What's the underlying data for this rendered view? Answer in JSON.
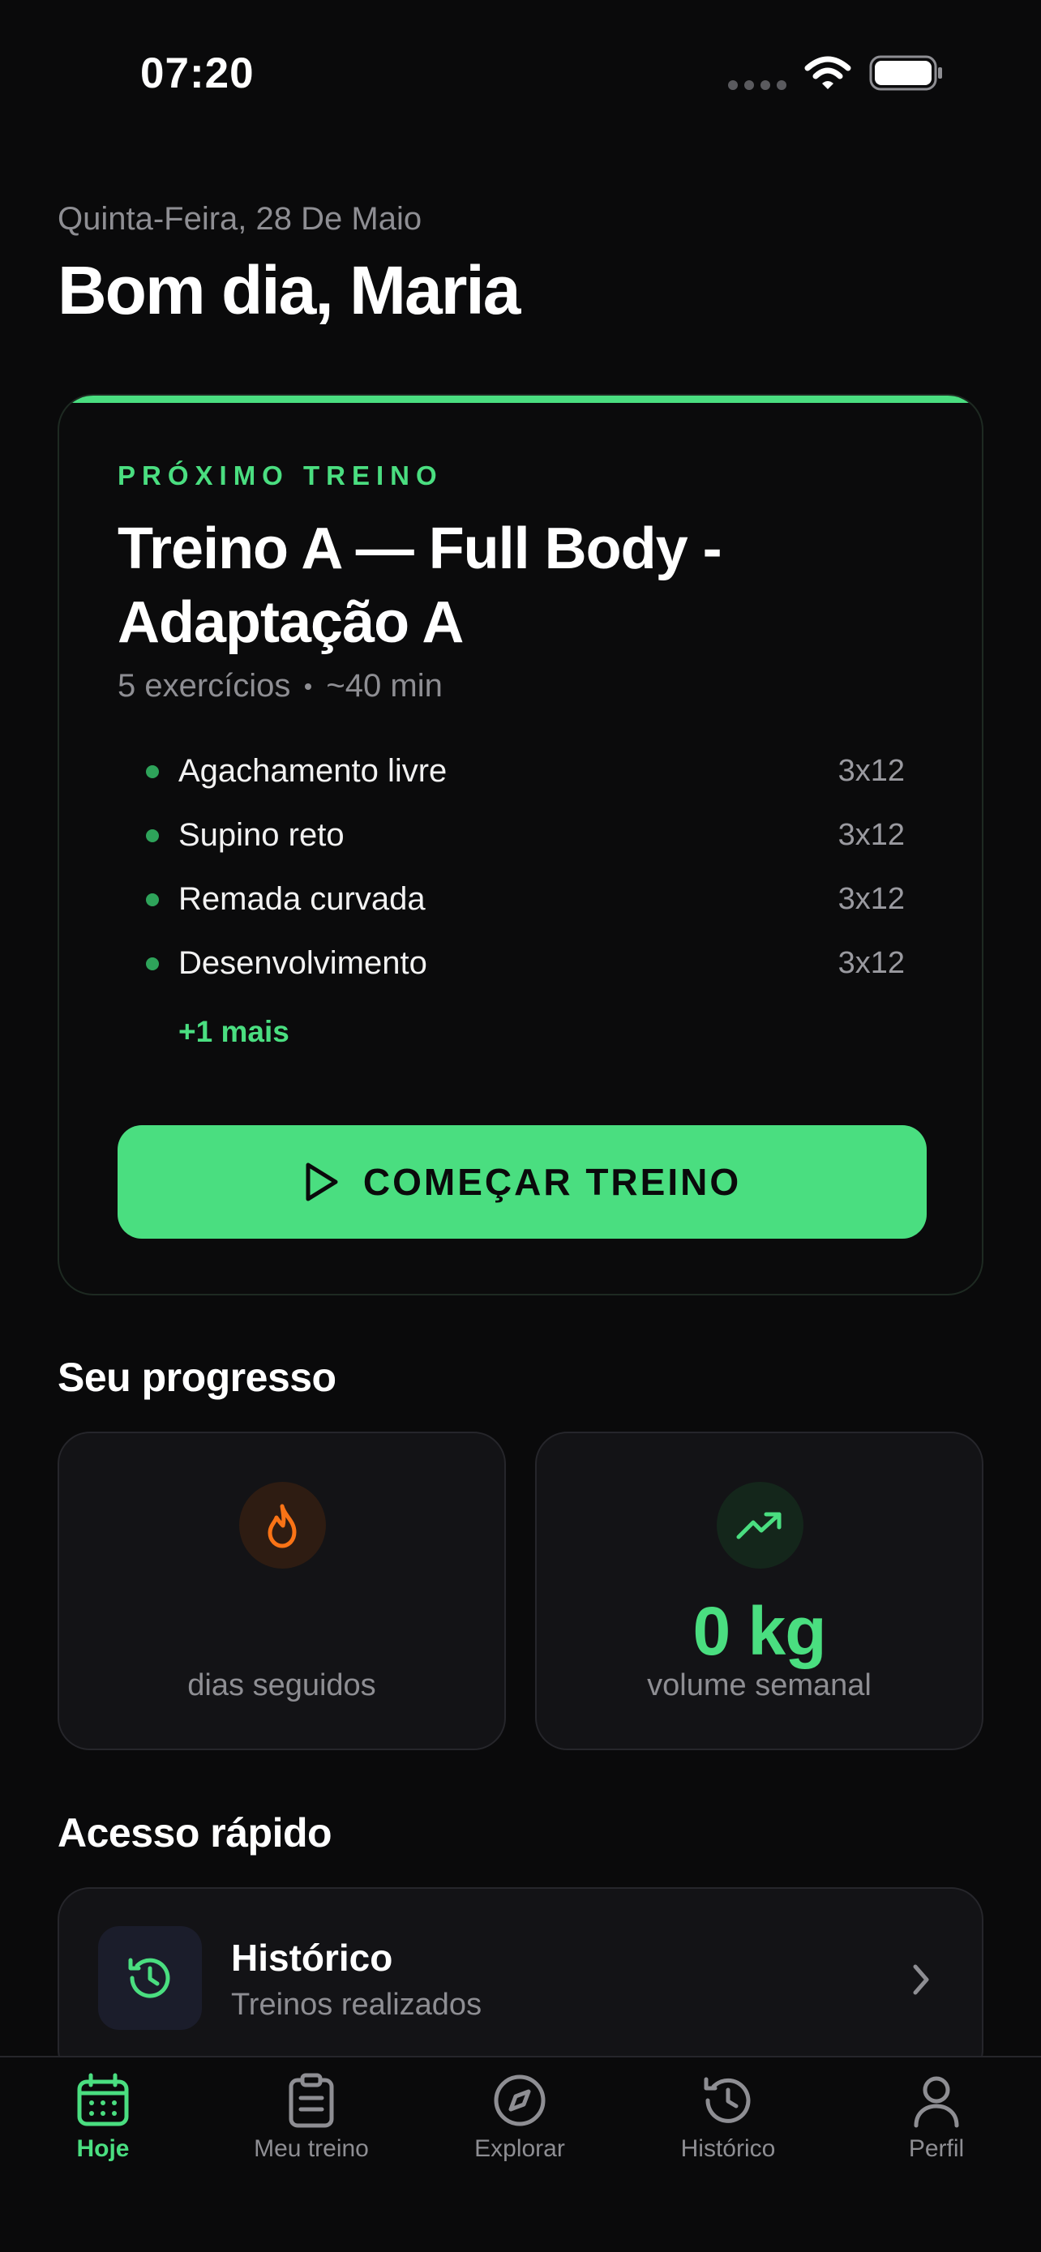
{
  "status_bar": {
    "time": "07:20"
  },
  "header": {
    "date": "Quinta-Feira, 28 De Maio",
    "greeting": "Bom dia, Maria"
  },
  "next_workout": {
    "eyebrow": "PRÓXIMO TREINO",
    "title": "Treino A — Full Body - Adaptação A",
    "exercise_count": "5 exercícios",
    "duration": "~40 min",
    "exercises": [
      {
        "name": "Agachamento livre",
        "sets": "3x12"
      },
      {
        "name": "Supino reto",
        "sets": "3x12"
      },
      {
        "name": "Remada curvada",
        "sets": "3x12"
      },
      {
        "name": "Desenvolvimento",
        "sets": "3x12"
      }
    ],
    "more_label": "+1 mais",
    "start_label": "COMEÇAR TREINO"
  },
  "progress": {
    "title": "Seu progresso",
    "streak": {
      "icon": "flame-icon",
      "value": "",
      "label": "dias seguidos"
    },
    "volume": {
      "icon": "trending-up-icon",
      "value": "0 kg",
      "label": "volume semanal"
    }
  },
  "quick_access": {
    "title": "Acesso rápido",
    "items": [
      {
        "icon": "history-icon",
        "title": "Histórico",
        "subtitle": "Treinos realizados"
      }
    ]
  },
  "tabs": [
    {
      "label": "Hoje",
      "icon": "calendar-icon",
      "active": true
    },
    {
      "label": "Meu treino",
      "icon": "clipboard-icon",
      "active": false
    },
    {
      "label": "Explorar",
      "icon": "compass-icon",
      "active": false
    },
    {
      "label": "Histórico",
      "icon": "history-icon",
      "active": false
    },
    {
      "label": "Perfil",
      "icon": "user-icon",
      "active": false
    }
  ],
  "colors": {
    "accent": "#4ade80",
    "streak": "#f97316",
    "background": "#0a0a0b",
    "card": "#131316"
  }
}
